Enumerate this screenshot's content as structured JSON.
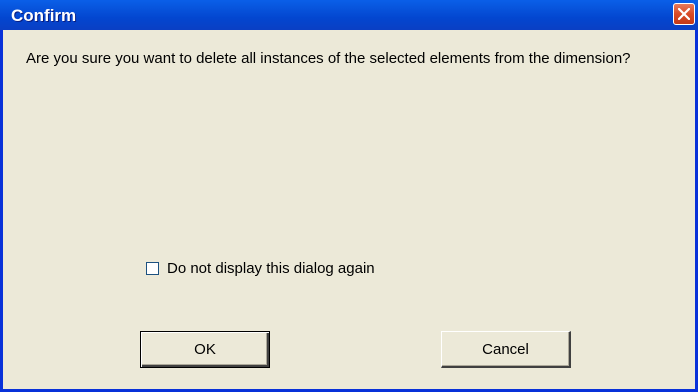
{
  "dialog": {
    "title": "Confirm",
    "message": "Are you sure you want to delete all instances of the selected elements from the dimension?",
    "checkbox_label": "Do not display this dialog again",
    "checkbox_checked": false,
    "ok_label": "OK",
    "cancel_label": "Cancel",
    "close_icon": "close-icon"
  },
  "colors": {
    "titlebar": "#0346d0",
    "close_button": "#d84a26",
    "dialog_background": "#ece9d8"
  }
}
